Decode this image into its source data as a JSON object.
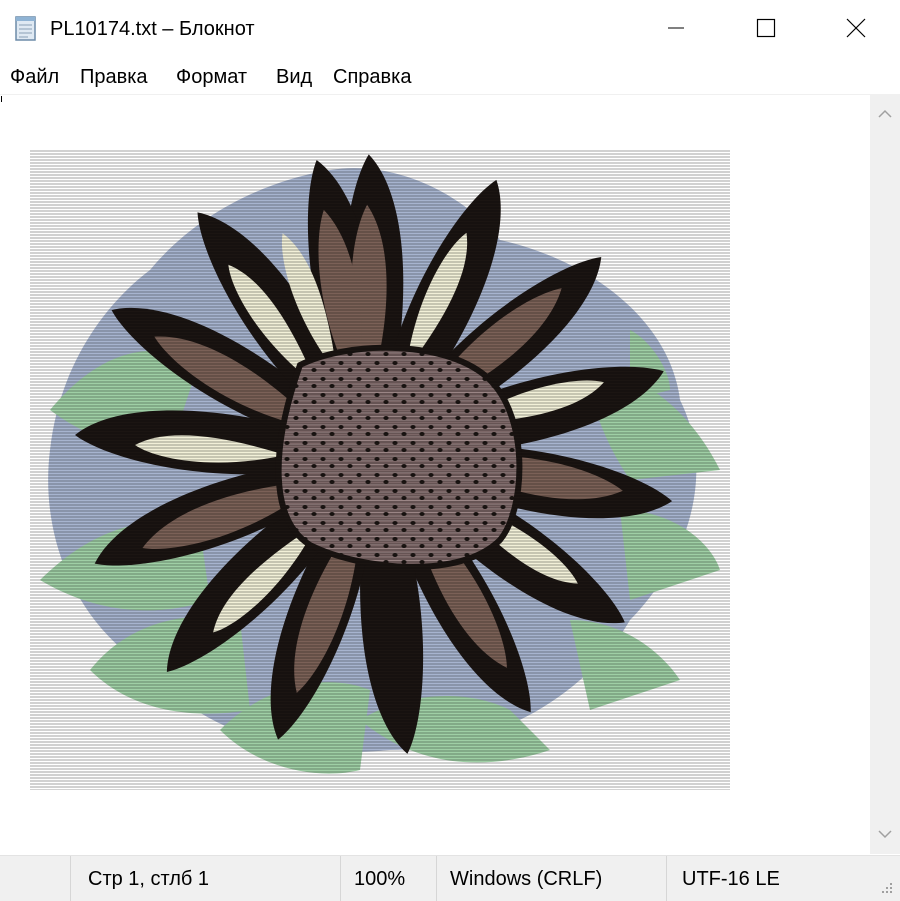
{
  "window": {
    "title": "PL10174.txt – Блокнот",
    "icon": "notepad-icon",
    "controls": [
      "minimize-icon",
      "maximize-icon",
      "close-icon"
    ]
  },
  "menu": {
    "items": [
      {
        "label": "Файл"
      },
      {
        "label": "Правка"
      },
      {
        "label": "Формат"
      },
      {
        "label": "Вид"
      },
      {
        "label": "Справка"
      }
    ]
  },
  "editor": {
    "content": "ASCII art: sunflower"
  },
  "status": {
    "position": "Стр 1, стлб 1",
    "zoom": "100%",
    "line_endings": "Windows (CRLF)",
    "encoding": "UTF-16 LE"
  },
  "colors": {
    "sky": "#a7b4cf",
    "leaf": "#9fcfa5",
    "petal_dark": "#1b1512",
    "petal_brown": "#7b6157",
    "petal_light": "#f2f0d8",
    "center": "#7c6767",
    "statusbar": "#f0f0f0"
  }
}
